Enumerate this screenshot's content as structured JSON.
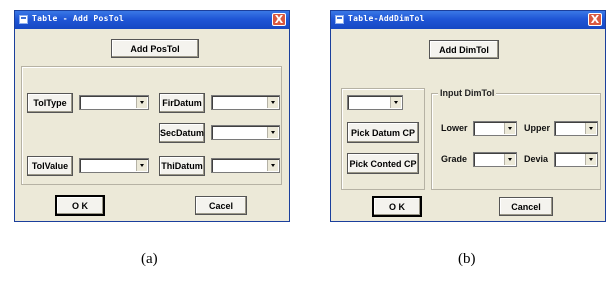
{
  "window_a": {
    "title": "Table - Add PosTol",
    "close_glyph": "X",
    "header_button": "Add PosTol",
    "tol_type_button": "TolType",
    "tol_value_button": "TolValue",
    "fir_datum_button": "FirDatum",
    "sec_datum_button": "SecDatum",
    "thi_datum_button": "ThiDatum",
    "ok_button": "O K",
    "cancel_button": "Cacel"
  },
  "window_b": {
    "title": "Table-AddDimTol",
    "close_glyph": "X",
    "header_button": "Add DimTol",
    "input_group_label": "Input DimTol",
    "pick_datum_button": "Pick Datum CP",
    "pick_conted_button": "Pick Conted CP",
    "lower_label": "Lower",
    "upper_label": "Upper",
    "grade_label": "Grade",
    "devia_label": "Devia",
    "ok_button": "O K",
    "cancel_button": "Cancel"
  },
  "captions": {
    "a": "(a)",
    "b": "(b)"
  }
}
